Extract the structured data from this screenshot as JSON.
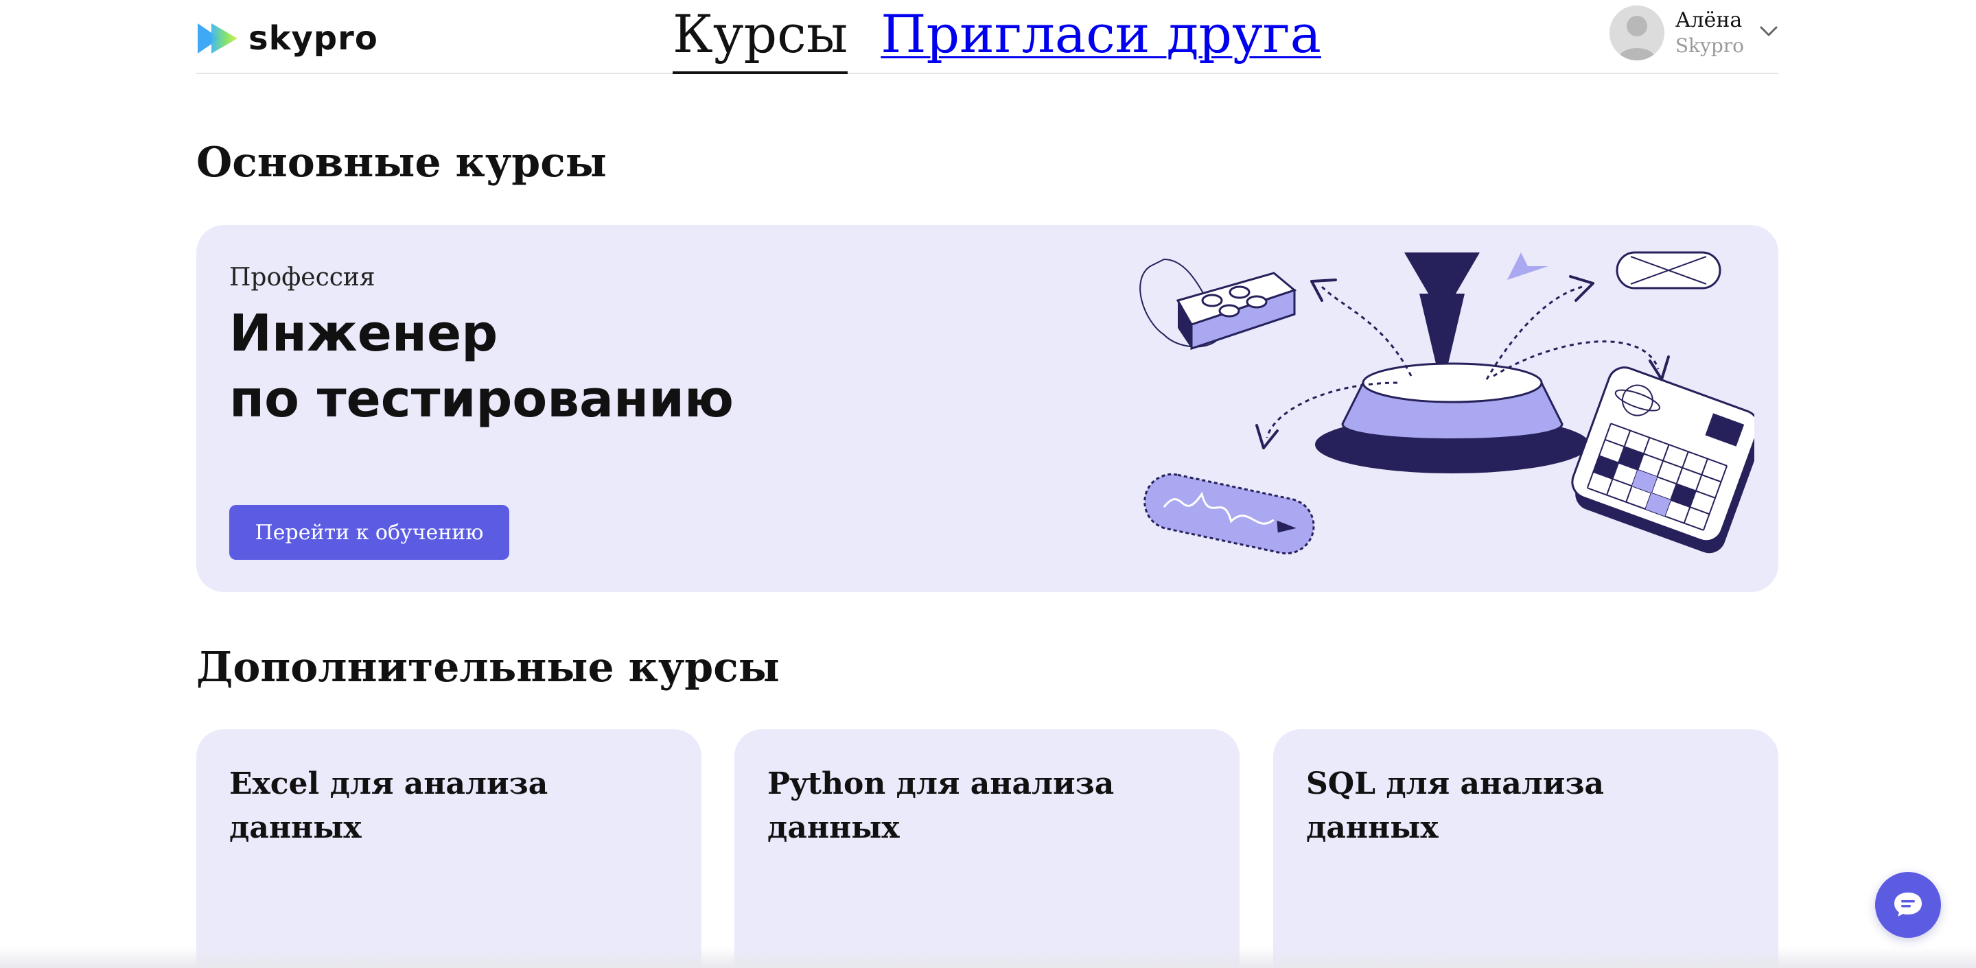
{
  "header": {
    "logo_text": "skypro",
    "nav": [
      {
        "label": "Курсы"
      },
      {
        "label": "Пригласи друга"
      }
    ],
    "user": {
      "name": "Алёна",
      "org": "Skypro"
    }
  },
  "main_section": {
    "title": "Основные курсы",
    "hero": {
      "kicker": "Профессия",
      "title_line1": "Инженер",
      "title_line2": "по тестированию",
      "button_label": "Перейти к обучению"
    }
  },
  "extra_section": {
    "title": "Дополнительные курсы",
    "cards": [
      {
        "title": "Excel для анализа данных"
      },
      {
        "title": "Python для анализа данных"
      },
      {
        "title": "SQL для анализа данных"
      }
    ]
  },
  "colors": {
    "accent": "#5b5ce2",
    "card_bg": "#ebeafb",
    "link": "#0000ee",
    "illustration_dark": "#26215a",
    "illustration_light": "#aaa8f0"
  },
  "icons": [
    "logo-play-icon",
    "avatar-icon",
    "chevron-down-icon",
    "chat-icon"
  ]
}
